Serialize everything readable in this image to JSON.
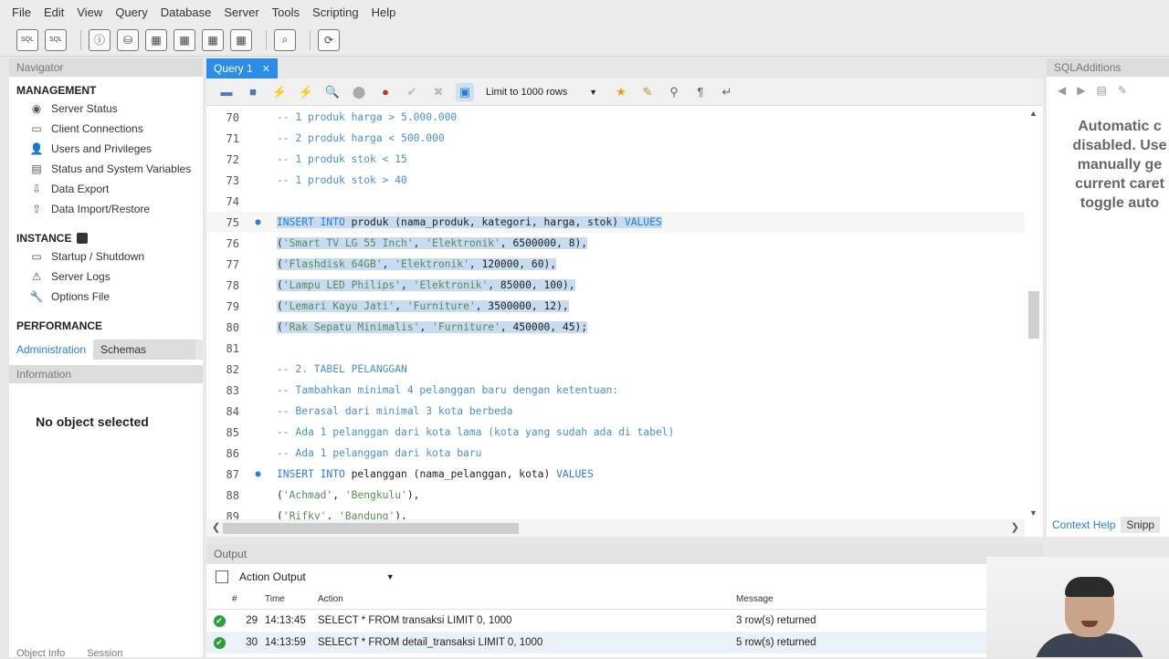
{
  "menu": [
    "File",
    "Edit",
    "View",
    "Query",
    "Database",
    "Server",
    "Tools",
    "Scripting",
    "Help"
  ],
  "toolbar_icons": [
    "new-sql-tab-icon",
    "open-sql-script-icon",
    "inspector-icon",
    "create-schema-icon",
    "create-table-icon",
    "create-view-icon",
    "create-procedure-icon",
    "create-function-icon",
    "search-table-data-icon",
    "reconnect-icon"
  ],
  "navigator": {
    "title": "Navigator",
    "management": {
      "title": "MANAGEMENT",
      "items": [
        {
          "label": "Server Status",
          "icon": "server-status-icon"
        },
        {
          "label": "Client Connections",
          "icon": "client-connections-icon"
        },
        {
          "label": "Users and Privileges",
          "icon": "user-icon"
        },
        {
          "label": "Status and System Variables",
          "icon": "variables-icon"
        },
        {
          "label": "Data Export",
          "icon": "data-export-icon"
        },
        {
          "label": "Data Import/Restore",
          "icon": "data-import-icon"
        }
      ]
    },
    "instance": {
      "title": "INSTANCE",
      "items": [
        {
          "label": "Startup / Shutdown",
          "icon": "startup-icon"
        },
        {
          "label": "Server Logs",
          "icon": "warning-icon"
        },
        {
          "label": "Options File",
          "icon": "wrench-icon"
        }
      ]
    },
    "performance": {
      "title": "PERFORMANCE"
    },
    "tabs": [
      "Administration",
      "Schemas"
    ],
    "information_title": "Information",
    "no_object": "No object selected",
    "bottom_tabs": [
      "Object Info",
      "Session"
    ]
  },
  "editor": {
    "tab_label": "Query 1",
    "limit_label": "Limit to 1000 rows",
    "lines": [
      {
        "n": "70",
        "t": "-- 1 produk harga > 5.000.000",
        "k": "comment",
        "dot": false,
        "sel": false
      },
      {
        "n": "71",
        "t": "-- 2 produk harga < 500.000",
        "k": "comment",
        "dot": false,
        "sel": false
      },
      {
        "n": "72",
        "t": "-- 1 produk stok < 15",
        "k": "comment",
        "dot": false,
        "sel": false
      },
      {
        "n": "73",
        "t": "-- 1 produk stok > 40",
        "k": "comment",
        "dot": false,
        "sel": false
      },
      {
        "n": "74",
        "t": "",
        "k": "plain",
        "dot": false,
        "sel": false
      },
      {
        "n": "75",
        "t": "INSERT INTO produk (nama_produk, kategori, harga, stok) VALUES",
        "k": "insert",
        "dot": true,
        "sel": true
      },
      {
        "n": "76",
        "t": "('Smart TV LG 55 Inch', 'Elektronik', 6500000, 8),",
        "k": "values",
        "dot": false,
        "sel": true
      },
      {
        "n": "77",
        "t": "('Flashdisk 64GB', 'Elektronik', 120000, 60),",
        "k": "values",
        "dot": false,
        "sel": true
      },
      {
        "n": "78",
        "t": "('Lampu LED Philips', 'Elektronik', 85000, 100),",
        "k": "values",
        "dot": false,
        "sel": true
      },
      {
        "n": "79",
        "t": "('Lemari Kayu Jati', 'Furniture', 3500000, 12),",
        "k": "values",
        "dot": false,
        "sel": true
      },
      {
        "n": "80",
        "t": "('Rak Sepatu Minimalis', 'Furniture', 450000, 45);",
        "k": "values",
        "dot": false,
        "sel": true
      },
      {
        "n": "81",
        "t": "",
        "k": "plain",
        "dot": false,
        "sel": false
      },
      {
        "n": "82",
        "t": "-- 2. TABEL PELANGGAN",
        "k": "comment",
        "dot": false,
        "sel": false
      },
      {
        "n": "83",
        "t": "-- Tambahkan minimal 4 pelanggan baru dengan ketentuan:",
        "k": "comment",
        "dot": false,
        "sel": false
      },
      {
        "n": "84",
        "t": "-- Berasal dari minimal 3 kota berbeda",
        "k": "comment",
        "dot": false,
        "sel": false
      },
      {
        "n": "85",
        "t": "-- Ada 1 pelanggan dari kota lama (kota yang sudah ada di tabel)",
        "k": "comment",
        "dot": false,
        "sel": false
      },
      {
        "n": "86",
        "t": "-- Ada 1 pelanggan dari kota baru",
        "k": "comment",
        "dot": false,
        "sel": false
      },
      {
        "n": "87",
        "t": "INSERT INTO pelanggan (nama_pelanggan, kota) VALUES",
        "k": "insert",
        "dot": true,
        "sel": false
      },
      {
        "n": "88",
        "t": "('Achmad', 'Bengkulu'),",
        "k": "values",
        "dot": false,
        "sel": false
      },
      {
        "n": "89",
        "t": "('Rifky', 'Bandung'),",
        "k": "values",
        "dot": false,
        "sel": false
      }
    ]
  },
  "sql_additions": {
    "title": "SQLAdditions",
    "help_lines": [
      "Automatic c",
      "disabled. Use",
      "manually ge",
      "current caret",
      "toggle auto"
    ],
    "bottom_tabs": [
      "Context Help",
      "Snipp"
    ]
  },
  "output": {
    "title": "Output",
    "selector": "Action Output",
    "columns": [
      "#",
      "Time",
      "Action",
      "Message"
    ],
    "rows": [
      {
        "num": "29",
        "time": "14:13:45",
        "action": "SELECT * FROM transaksi LIMIT 0, 1000",
        "message": "3 row(s) returned"
      },
      {
        "num": "30",
        "time": "14:13:59",
        "action": "SELECT * FROM detail_transaksi LIMIT 0, 1000",
        "message": "5 row(s) returned"
      }
    ]
  },
  "colors": {
    "accent": "#2c8ce6",
    "selection": "#c7dcf0",
    "comment": "#4a8fc8",
    "success": "#2e9e3e"
  }
}
